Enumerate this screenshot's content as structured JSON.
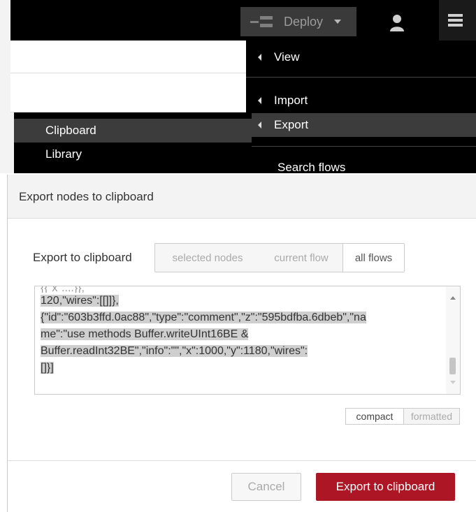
{
  "header": {
    "deploy_label": "Deploy"
  },
  "main_menu": {
    "items": [
      {
        "label": "View",
        "submenu": true
      },
      {
        "label": "Import",
        "submenu": true
      },
      {
        "label": "Export",
        "submenu": true,
        "active": true
      },
      {
        "label": "Search flows",
        "submenu": false
      }
    ]
  },
  "export_submenu": {
    "items": [
      {
        "label": "Clipboard",
        "active": true
      },
      {
        "label": "Library",
        "active": false
      }
    ]
  },
  "dialog": {
    "title": "Export nodes to clipboard",
    "export_label": "Export to clipboard",
    "scope_options": [
      "selected nodes",
      "current flow",
      "all flows"
    ],
    "scope_selected": "all flows",
    "json_lines": [
      "120,\"wires\":[[]]},",
      "{\"id\":\"603b3ffd.0ac88\",\"type\":\"comment\",\"z\":\"595bdfba.6dbeb\",\"na",
      "me\":\"use methods Buffer.writeUInt16BE &",
      "Buffer.readInt32BE\",\"info\":\"\",\"x\":1000,\"y\":1180,\"wires\":",
      "[]}]"
    ],
    "format_options": [
      "compact",
      "formatted"
    ],
    "format_selected": "compact",
    "cancel_label": "Cancel",
    "export_button_label": "Export to clipboard"
  },
  "colors": {
    "header_bg": "#000000",
    "menu_bg": "#000000",
    "menu_active_bg": "#3c3c3c",
    "primary_button": "#ad1625"
  }
}
